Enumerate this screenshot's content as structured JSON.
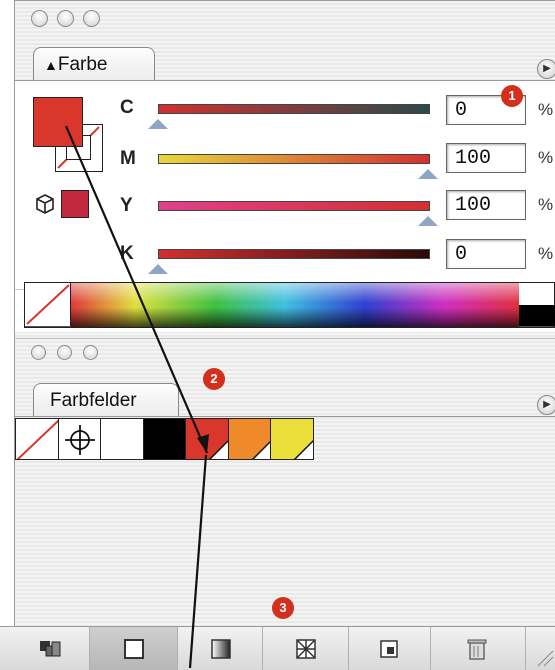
{
  "colors": {
    "fill": "#d9362c",
    "gamut_warning": "#c2283e",
    "cyan_bar_end": "#2a4a4a",
    "magenta_bar_start": "#e8d83a",
    "yellow_bar_start": "#e0408a",
    "black_bar_start": "#d43030",
    "badge": "#d32f1c"
  },
  "farbe_panel": {
    "tab_label": "Farbe",
    "tab_icon": "updown-arrows-icon",
    "sliders": [
      {
        "key": "C",
        "label": "C",
        "value": "0",
        "unit": "%",
        "level": 0
      },
      {
        "key": "M",
        "label": "M",
        "value": "100",
        "unit": "%",
        "level": 100
      },
      {
        "key": "Y",
        "label": "Y",
        "value": "100",
        "unit": "%",
        "level": 100
      },
      {
        "key": "K",
        "label": "K",
        "value": "0",
        "unit": "%",
        "level": 0
      }
    ]
  },
  "farbfelder_panel": {
    "tab_label": "Farbfelder",
    "swatches": [
      {
        "name": "none",
        "color": "#ffffff"
      },
      {
        "name": "registration",
        "color": "#ffffff"
      },
      {
        "name": "white",
        "color": "#ffffff"
      },
      {
        "name": "black",
        "color": "#000000"
      },
      {
        "name": "red",
        "color": "#d9362c"
      },
      {
        "name": "orange",
        "color": "#ee8a2a"
      },
      {
        "name": "yellow",
        "color": "#ebe03a"
      }
    ]
  },
  "toolbar": {
    "buttons": [
      "show-all-swatches-icon",
      "color-swatches-icon",
      "gradient-swatches-icon",
      "pattern-swatches-icon",
      "new-swatch-icon",
      "trash-icon"
    ]
  },
  "badges": {
    "one": "1",
    "two": "2",
    "three": "3"
  }
}
